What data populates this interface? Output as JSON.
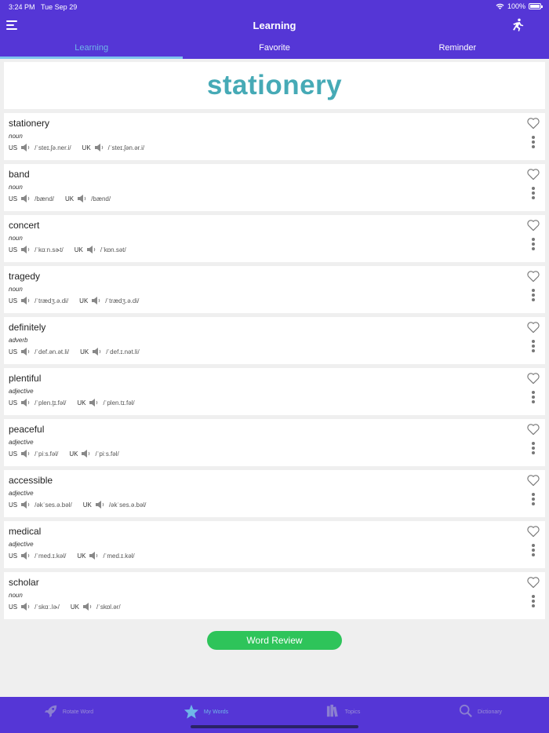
{
  "status": {
    "time": "3:24 PM",
    "date": "Tue Sep 29",
    "battery": "100%"
  },
  "navbar": {
    "title": "Learning"
  },
  "tabs": [
    {
      "label": "Learning",
      "active": true
    },
    {
      "label": "Favorite",
      "active": false
    },
    {
      "label": "Reminder",
      "active": false
    }
  ],
  "hero": {
    "word": "stationery"
  },
  "words": [
    {
      "word": "stationery",
      "pos": "noun",
      "us_label": "US",
      "us_ipa": "/ˈsteɪ.ʃə.ner.i/",
      "uk_label": "UK",
      "uk_ipa": "/ˈsteɪ.ʃən.ər.i/"
    },
    {
      "word": "band",
      "pos": "noun",
      "us_label": "US",
      "us_ipa": "/bænd/",
      "uk_label": "UK",
      "uk_ipa": "/bænd/"
    },
    {
      "word": "concert",
      "pos": "noun",
      "us_label": "US",
      "us_ipa": "/ˈkɑːn.sɚt/",
      "uk_label": "UK",
      "uk_ipa": "/ˈkɒn.sət/"
    },
    {
      "word": "tragedy",
      "pos": "noun",
      "us_label": "US",
      "us_ipa": "/ˈtrædʒ.ə.di/",
      "uk_label": "UK",
      "uk_ipa": "/ˈtrædʒ.ə.di/"
    },
    {
      "word": "definitely",
      "pos": "adverb",
      "us_label": "US",
      "us_ipa": "/ˈdef.ən.ət.li/",
      "uk_label": "UK",
      "uk_ipa": "/ˈdef.ɪ.nət.li/"
    },
    {
      "word": "plentiful",
      "pos": "adjective",
      "us_label": "US",
      "us_ipa": "/ˈplen.t̬ɪ.fəl/",
      "uk_label": "UK",
      "uk_ipa": "/ˈplen.tɪ.fəl/"
    },
    {
      "word": "peaceful",
      "pos": "adjective",
      "us_label": "US",
      "us_ipa": "/ˈpiːs.fəl/",
      "uk_label": "UK",
      "uk_ipa": "/ˈpiːs.fəl/"
    },
    {
      "word": "accessible",
      "pos": "adjective",
      "us_label": "US",
      "us_ipa": "/əkˈses.ə.bəl/",
      "uk_label": "UK",
      "uk_ipa": "/əkˈses.ə.bəl/"
    },
    {
      "word": "medical",
      "pos": "adjective",
      "us_label": "US",
      "us_ipa": "/ˈmed.ɪ.kəl/",
      "uk_label": "UK",
      "uk_ipa": "/ˈmed.ɪ.kəl/"
    },
    {
      "word": "scholar",
      "pos": "noun",
      "us_label": "US",
      "us_ipa": "/ˈskɑː.lɚ/",
      "uk_label": "UK",
      "uk_ipa": "/ˈskɒl.ər/"
    }
  ],
  "review_button": {
    "label": "Word Review"
  },
  "bottom_tabs": [
    {
      "label": "Rotate Word",
      "icon": "rocket-icon",
      "active": false
    },
    {
      "label": "My Words",
      "icon": "star-icon",
      "active": true
    },
    {
      "label": "Topics",
      "icon": "books-icon",
      "active": false
    },
    {
      "label": "Dictionary",
      "icon": "search-icon",
      "active": false
    }
  ],
  "colors": {
    "brand": "#5536d6",
    "accent": "#6fb6e8",
    "hero_text": "#46aab6",
    "review_button": "#2ec45a"
  }
}
